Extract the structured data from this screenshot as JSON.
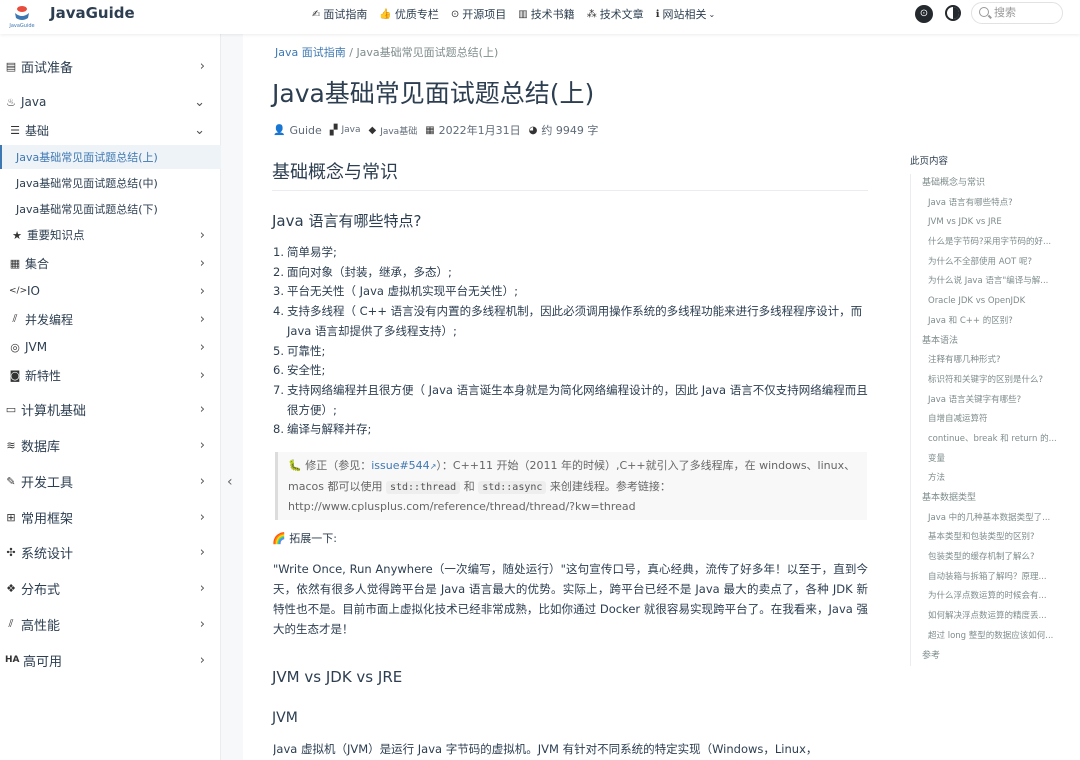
{
  "navbar": {
    "brand": "JavaGuide",
    "links": [
      {
        "icon": "✍",
        "label": "面试指南",
        "dropdown": false
      },
      {
        "icon": "👍",
        "label": "优质专栏",
        "dropdown": false
      },
      {
        "icon": "⊙",
        "label": "开源项目",
        "dropdown": false
      },
      {
        "icon": "▥",
        "label": "技术书籍",
        "dropdown": false
      },
      {
        "icon": "⁂",
        "label": "技术文章",
        "dropdown": false
      },
      {
        "icon": "ℹ",
        "label": "网站相关",
        "dropdown": true
      }
    ],
    "search_placeholder": "搜索"
  },
  "sidebar": {
    "items": [
      {
        "label": "面试准备",
        "icon": "▤",
        "arrow": "›",
        "level": "top"
      },
      {
        "label": "Java",
        "icon": "♨",
        "arrow": "⌄",
        "level": "sub"
      },
      {
        "label": "基础",
        "icon": "☰",
        "arrow": "⌄",
        "level": "sub"
      },
      {
        "label": "Java基础常见面试题总结(上)",
        "level": "leaf",
        "active": true
      },
      {
        "label": "Java基础常见面试题总结(中)",
        "level": "leaf"
      },
      {
        "label": "Java基础常见面试题总结(下)",
        "level": "leaf"
      },
      {
        "label": "重要知识点",
        "icon": "★",
        "arrow": "›",
        "level": "subsub"
      },
      {
        "label": "集合",
        "icon": "▦",
        "arrow": "›",
        "level": "sub"
      },
      {
        "label": "IO",
        "icon": "</>",
        "arrow": "›",
        "level": "sub"
      },
      {
        "label": "并发编程",
        "icon": "⫽",
        "arrow": "›",
        "level": "sub"
      },
      {
        "label": "JVM",
        "icon": "◎",
        "arrow": "›",
        "level": "sub"
      },
      {
        "label": "新特性",
        "icon": "◙",
        "arrow": "›",
        "level": "sub"
      },
      {
        "label": "计算机基础",
        "icon": "▭",
        "arrow": "›",
        "level": "top"
      },
      {
        "label": "数据库",
        "icon": "≋",
        "arrow": "›",
        "level": "top"
      },
      {
        "label": "开发工具",
        "icon": "✎",
        "arrow": "›",
        "level": "top"
      },
      {
        "label": "常用框架",
        "icon": "⊞",
        "arrow": "›",
        "level": "top"
      },
      {
        "label": "系统设计",
        "icon": "✣",
        "arrow": "›",
        "level": "top"
      },
      {
        "label": "分布式",
        "icon": "❖",
        "arrow": "›",
        "level": "top"
      },
      {
        "label": "高性能",
        "icon": "⫽",
        "arrow": "›",
        "level": "top"
      },
      {
        "label": "高可用",
        "icon": "HA",
        "arrow": "›",
        "level": "top"
      }
    ]
  },
  "breadcrumb": {
    "parent": "Java 面试指南",
    "current": "Java基础常见面试题总结(上)"
  },
  "article": {
    "title": "Java基础常见面试题总结(上)",
    "author": "Guide",
    "category": "Java",
    "tag": "Java基础",
    "date": "2022年1月31日",
    "word_count": "约 9949 字",
    "h2": "基础概念与常识",
    "h3_features": "Java 语言有哪些特点?",
    "features": [
      "简单易学;",
      "面向对象（封装，继承，多态）;",
      "平台无关性（ Java 虚拟机实现平台无关性）;",
      "支持多线程（ C++ 语言没有内置的多线程机制，因此必须调用操作系统的多线程功能来进行多线程程序设计，而 Java 语言却提供了多线程支持）;",
      "可靠性;",
      "安全性;",
      "支持网络编程并且很方便（ Java 语言诞生本身就是为简化网络编程设计的，因此 Java 语言不仅支持网络编程而且很方便）;",
      "编译与解释并存;"
    ],
    "tip": {
      "prefix": "🐛 修正（参见：",
      "link": "issue#544",
      "after_link": "）：C++11 开始（2011 年的时候）,C++就引入了多线程库，在 windows、linux、macos 都可以使用",
      "code1": "std::thread",
      "and": "和",
      "code2": "std::async",
      "suffix": "来创建线程。参考链接：http://www.cplusplus.com/reference/thread/thread/?kw=thread"
    },
    "expand_label": "🌈 拓展一下:",
    "expand_paragraph": "\"Write Once, Run Anywhere（一次编写，随处运行）\"这句宣传口号，真心经典，流传了好多年！以至于，直到今天，依然有很多人觉得跨平台是 Java 语言最大的优势。实际上，跨平台已经不是 Java 最大的卖点了，各种 JDK 新特性也不是。目前市面上虚拟化技术已经非常成熟，比如你通过 Docker 就很容易实现跨平台了。在我看来，Java 强大的生态才是！",
    "h3_jvm_jdk_jre": "JVM vs JDK vs JRE",
    "h4_jvm": "JVM",
    "jvm_paragraph": "Java 虚拟机（JVM）是运行 Java 字节码的虚拟机。JVM 有针对不同系统的特定实现（Windows，Linux，"
  },
  "toc": {
    "title": "此页内容",
    "items": [
      {
        "label": "基础概念与常识",
        "level": 1
      },
      {
        "label": "Java 语言有哪些特点?",
        "level": 2
      },
      {
        "label": "JVM vs JDK vs JRE",
        "level": 2
      },
      {
        "label": "什么是字节码?采用字节码的好...",
        "level": 2
      },
      {
        "label": "为什么不全部使用 AOT 呢?",
        "level": 2
      },
      {
        "label": "为什么说 Java 语言\"编译与解...",
        "level": 2
      },
      {
        "label": "Oracle JDK vs OpenJDK",
        "level": 2
      },
      {
        "label": "Java 和 C++ 的区别?",
        "level": 2
      },
      {
        "label": "基本语法",
        "level": 1
      },
      {
        "label": "注释有哪几种形式?",
        "level": 2
      },
      {
        "label": "标识符和关键字的区别是什么?",
        "level": 2
      },
      {
        "label": "Java 语言关键字有哪些?",
        "level": 2
      },
      {
        "label": "自增自减运算符",
        "level": 2
      },
      {
        "label": "continue、break 和 return 的...",
        "level": 2
      },
      {
        "label": "变量",
        "level": 2
      },
      {
        "label": "方法",
        "level": 2
      },
      {
        "label": "基本数据类型",
        "level": 1
      },
      {
        "label": "Java 中的几种基本数据类型了...",
        "level": 2
      },
      {
        "label": "基本类型和包装类型的区别?",
        "level": 2
      },
      {
        "label": "包装类型的缓存机制了解么?",
        "level": 2
      },
      {
        "label": "自动装箱与拆箱了解吗？原理...",
        "level": 2
      },
      {
        "label": "为什么浮点数运算的时候会有...",
        "level": 2
      },
      {
        "label": "如何解决浮点数运算的精度丢...",
        "level": 2
      },
      {
        "label": "超过 long 整型的数据应该如何...",
        "level": 2
      },
      {
        "label": "参考",
        "level": 1
      }
    ]
  }
}
